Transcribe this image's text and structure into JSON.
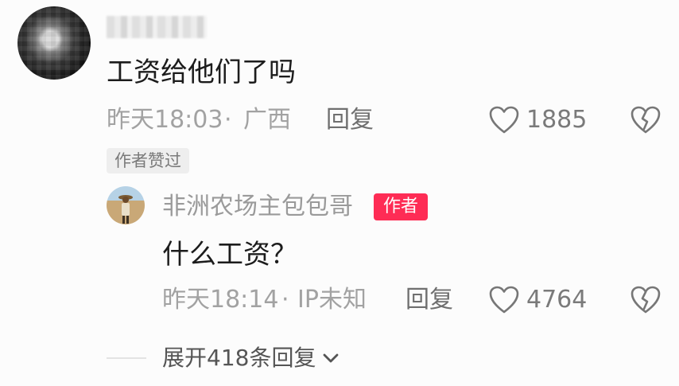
{
  "comment": {
    "text": "工资给他们了吗",
    "time": "昨天18:03",
    "location": "广西",
    "separator": "·",
    "reply_label": "回复",
    "like_count": "1885",
    "author_liked_badge": "作者赞过"
  },
  "reply": {
    "username": "非洲农场主包包哥",
    "author_badge": "作者",
    "text": "什么工资？",
    "time": "昨天18:14",
    "location": "IP未知",
    "separator": "·",
    "reply_label": "回复",
    "like_count": "4764"
  },
  "expand": {
    "label": "展开418条回复"
  },
  "colors": {
    "author_badge_bg": "#fe2c55",
    "meta_text": "#a2a2a2"
  }
}
